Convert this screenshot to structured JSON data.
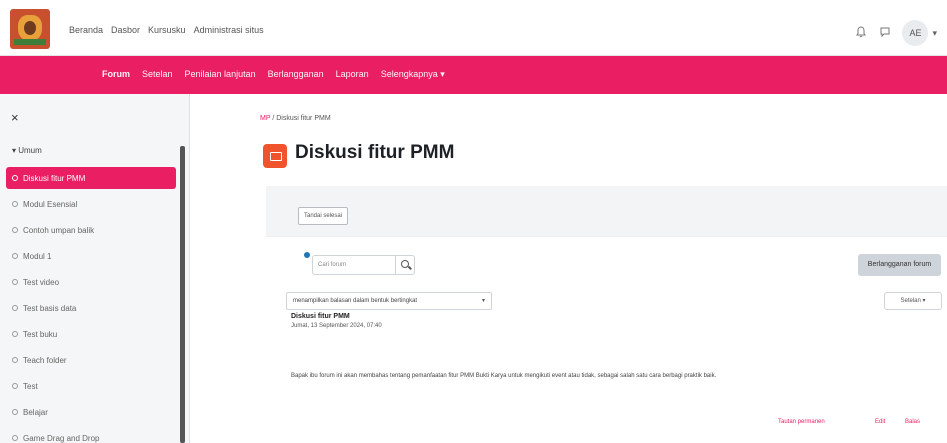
{
  "topbar": {
    "nav": [
      "Beranda",
      "Dasbor",
      "Kursusku",
      "Administrasi situs"
    ],
    "avatar_initials": "AE"
  },
  "secnav": {
    "items": [
      "Forum",
      "Setelan",
      "Penilaian lanjutan",
      "Berlangganan",
      "Laporan",
      "Selengkapnya ▾"
    ],
    "active_index": 0
  },
  "sidebar": {
    "close_glyph": "×",
    "section_label": "▾ Umum",
    "items": [
      {
        "label": "Diskusi fitur PMM",
        "active": true
      },
      {
        "label": "Modul Esensial",
        "active": false
      },
      {
        "label": "Contoh umpan balik",
        "active": false
      },
      {
        "label": "Modul 1",
        "active": false
      },
      {
        "label": "Test video",
        "active": false
      },
      {
        "label": "Test basis data",
        "active": false
      },
      {
        "label": "Test buku",
        "active": false
      },
      {
        "label": "Teach folder",
        "active": false
      },
      {
        "label": "Test",
        "active": false
      },
      {
        "label": "Belajar",
        "active": false
      },
      {
        "label": "Game Drag and Drop",
        "active": false
      }
    ]
  },
  "main": {
    "breadcrumb_link": "MP",
    "breadcrumb_sep": " / ",
    "breadcrumb_current": "Diskusi fitur PMM",
    "title": "Diskusi fitur PMM",
    "mark_done_label": "Tandai selesai",
    "search_placeholder": "Cari forum",
    "subscribe_label": "Berlangganan forum",
    "display_mode": "menampilkan balasan dalam bentuk bertingkat",
    "settings_label": "Setelan ▾",
    "post": {
      "title": "Diskusi fitur PMM",
      "meta": "Jumat, 13 September 2024, 07:40",
      "body": "Bapak ibu forum ini akan membahas tentang pemanfaatan fitur PMM Bukti Karya untuk mengikuti event atau tidak, sebagai salah satu cara berbagi praktik baik."
    },
    "actions": [
      "Tautan permanen",
      "Edit",
      "Balas"
    ]
  },
  "colors": {
    "accent": "#e91e63",
    "title_icon": "#f0542d",
    "sidebar_bg": "#f5f6f7"
  }
}
